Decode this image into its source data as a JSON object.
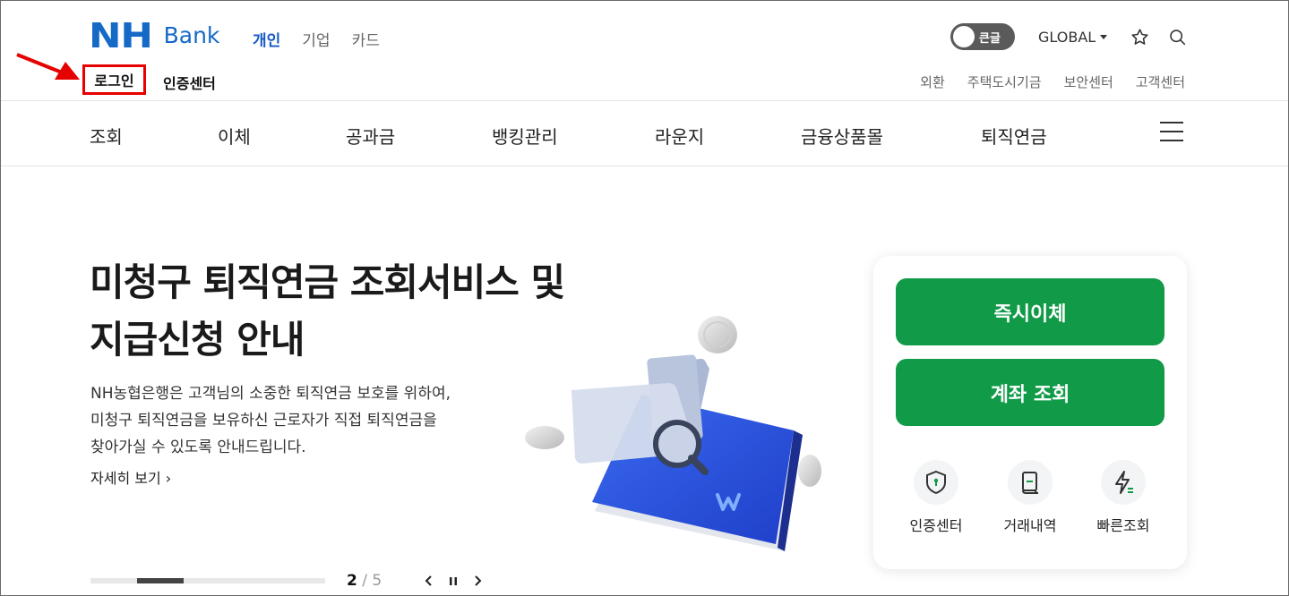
{
  "header": {
    "logo_nh": "NH",
    "logo_bank": "Bank",
    "tabs": [
      {
        "label": "개인",
        "active": true
      },
      {
        "label": "기업",
        "active": false
      },
      {
        "label": "카드",
        "active": false
      }
    ],
    "toggle_label": "큰글",
    "global_label": "GLOBAL",
    "login_label": "로그인",
    "cert_center_label": "인증센터",
    "util_links": [
      "외환",
      "주택도시기금",
      "보안센터",
      "고객센터"
    ]
  },
  "gnb": [
    "조회",
    "이체",
    "공과금",
    "뱅킹관리",
    "라운지",
    "금융상품몰",
    "퇴직연금"
  ],
  "hero": {
    "title_line1": "미청구 퇴직연금 조회서비스 및",
    "title_line2": "지급신청 안내",
    "desc_line1": "NH농협은행은 고객님의 소중한 퇴직연금 보호를 위하여,",
    "desc_line2": "미청구 퇴직연금을 보유하신 근로자가 직접 퇴직연금을",
    "desc_line3": "찾아가실 수 있도록 안내드립니다.",
    "more_label": "자세히 보기 ›"
  },
  "slider": {
    "current": "2",
    "separator": " / ",
    "total": "5",
    "progress_fraction": 0.4
  },
  "quick": {
    "transfer_label": "즉시이체",
    "account_label": "계좌 조회",
    "items": [
      {
        "label": "인증센터",
        "icon": "shield-icon"
      },
      {
        "label": "거래내역",
        "icon": "receipt-icon"
      },
      {
        "label": "빠른조회",
        "icon": "lightning-icon"
      }
    ]
  },
  "colors": {
    "brand_blue": "#1569c7",
    "active_tab": "#1558c6",
    "green": "#119b48",
    "highlight_red": "#e60000"
  }
}
